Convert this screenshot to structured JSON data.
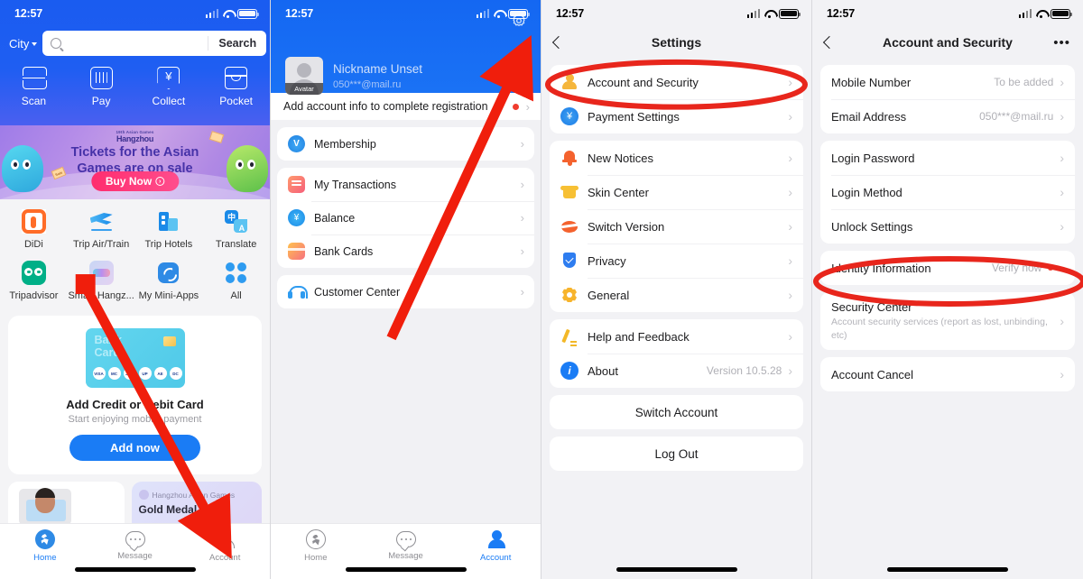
{
  "status_bar": {
    "time": "12:57"
  },
  "panel1": {
    "search": {
      "city_label": "City",
      "placeholder": "",
      "value": "",
      "search_button": "Search"
    },
    "quick_actions": [
      {
        "label": "Scan",
        "icon": "scan-icon"
      },
      {
        "label": "Pay",
        "icon": "barcode-icon"
      },
      {
        "label": "Collect",
        "icon": "yuan-collect-icon"
      },
      {
        "label": "Pocket",
        "icon": "pocket-icon"
      }
    ],
    "banner": {
      "logo_small": "19th Asian Games",
      "logo_big": "Hangzhou",
      "title_line1": "Tickets for the Asian",
      "title_line2": "Games are on sale",
      "button": "Buy Now",
      "tag": "Sale"
    },
    "apps": [
      {
        "label": "DiDi",
        "icon": "didi-icon"
      },
      {
        "label": "Trip Air/Train",
        "icon": "trip-air-train-icon"
      },
      {
        "label": "Trip Hotels",
        "icon": "trip-hotels-icon"
      },
      {
        "label": "Translate",
        "icon": "translate-icon"
      },
      {
        "label": "Tripadvisor",
        "icon": "tripadvisor-icon"
      },
      {
        "label": "Smart Hangz...",
        "icon": "smart-hangzhou-icon"
      },
      {
        "label": "My Mini-Apps",
        "icon": "mini-apps-icon"
      },
      {
        "label": "All",
        "icon": "grid-all-icon"
      }
    ],
    "card_panel": {
      "card_text_line1": "Bank",
      "card_text_line2": "Card",
      "networks": [
        "VISA",
        "MC",
        "JCB",
        "UP",
        "AE",
        "DC"
      ],
      "title": "Add Credit or Debit Card",
      "subtitle": "Start enjoying mobile payment",
      "button": "Add now"
    },
    "mini_cards": [
      {
        "type": "photo"
      },
      {
        "header": "Hangzhou Asian Games",
        "title": "Gold Medal"
      }
    ],
    "tabbar": [
      {
        "label": "Home",
        "icon": "home-icon",
        "active": true
      },
      {
        "label": "Message",
        "icon": "message-icon",
        "active": false
      },
      {
        "label": "Account",
        "icon": "account-icon",
        "active": false
      }
    ]
  },
  "panel2": {
    "gear_icon": "gear-icon",
    "profile": {
      "avatar_tag": "Avatar",
      "nickname": "Nickname Unset",
      "email": "050***@mail.ru"
    },
    "registration_row": "Add account info to complete registration",
    "groups": [
      [
        {
          "label": "Membership",
          "icon": "membership-icon"
        }
      ],
      [
        {
          "label": "My Transactions",
          "icon": "transactions-icon"
        },
        {
          "label": "Balance",
          "icon": "balance-icon"
        },
        {
          "label": "Bank Cards",
          "icon": "bank-cards-icon"
        }
      ],
      [
        {
          "label": "Customer Center",
          "icon": "customer-service-icon"
        }
      ]
    ],
    "tabbar": [
      {
        "label": "Home",
        "icon": "home-icon",
        "active": false
      },
      {
        "label": "Message",
        "icon": "message-icon",
        "active": false
      },
      {
        "label": "Account",
        "icon": "account-icon",
        "active": true
      }
    ]
  },
  "panel3": {
    "nav": {
      "back_icon": "back-chevron-icon",
      "title": "Settings"
    },
    "groups": [
      [
        {
          "label": "Account and Security",
          "icon": "account-security-icon",
          "value": "",
          "highlighted": true
        },
        {
          "label": "Payment Settings",
          "icon": "payment-settings-icon",
          "value": ""
        }
      ],
      [
        {
          "label": "New Notices",
          "icon": "bell-icon",
          "value": ""
        },
        {
          "label": "Skin Center",
          "icon": "shirt-icon",
          "value": ""
        },
        {
          "label": "Switch Version",
          "icon": "switch-version-icon",
          "value": ""
        },
        {
          "label": "Privacy",
          "icon": "shield-check-icon",
          "value": ""
        },
        {
          "label": "General",
          "icon": "gear-icon",
          "value": ""
        }
      ],
      [
        {
          "label": "Help and Feedback",
          "icon": "pencil-icon",
          "value": ""
        },
        {
          "label": "About",
          "icon": "info-icon",
          "value": "Version 10.5.28"
        }
      ]
    ],
    "buttons": [
      "Switch Account",
      "Log Out"
    ]
  },
  "panel4": {
    "nav": {
      "back_icon": "back-chevron-icon",
      "title": "Account and Security",
      "more_icon": "more-dots-icon"
    },
    "groups": [
      [
        {
          "label": "Mobile Number",
          "value": "To be added"
        },
        {
          "label": "Email Address",
          "value": "050***@mail.ru"
        }
      ],
      [
        {
          "label": "Login Password",
          "value": ""
        },
        {
          "label": "Login Method",
          "value": ""
        },
        {
          "label": "Unlock Settings",
          "value": ""
        }
      ],
      [
        {
          "label": "Identity Information",
          "value": "Verify now",
          "dot": true,
          "highlighted": true
        }
      ],
      [
        {
          "label": "Security Center",
          "value": "",
          "sub": "Account security services (report as lost, unbinding, etc)"
        }
      ],
      [
        {
          "label": "Account Cancel",
          "value": ""
        }
      ]
    ]
  },
  "annotations": {
    "arrow_color": "#f01e0c",
    "circle_color": "#e8261c"
  }
}
